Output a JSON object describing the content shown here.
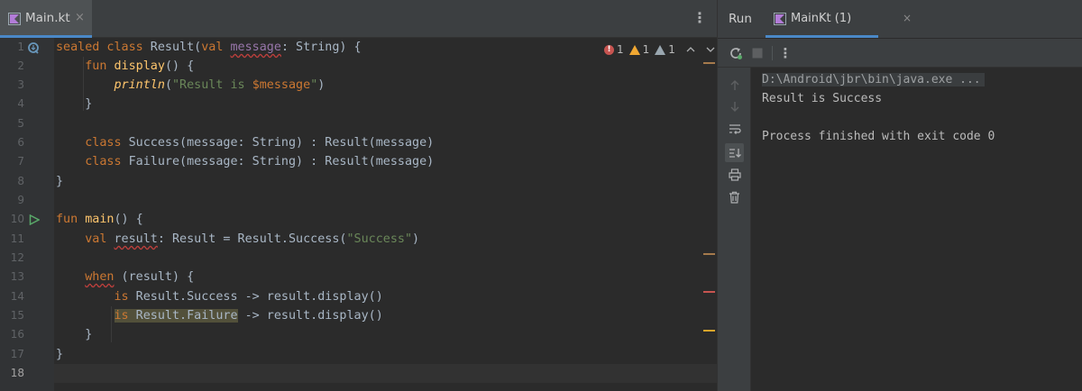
{
  "editor": {
    "tab": {
      "label": "Main.kt",
      "close": "×"
    },
    "more": "⋮",
    "inspections": {
      "errors": "1",
      "warnings": "1",
      "weak_warnings": "1",
      "error_glyph": "!"
    },
    "line_numbers": [
      "1",
      "2",
      "3",
      "4",
      "5",
      "6",
      "7",
      "8",
      "9",
      "10",
      "11",
      "12",
      "13",
      "14",
      "15",
      "16",
      "17",
      "18"
    ],
    "lines": {
      "l1": {
        "kw": "sealed class",
        "name": " Result(",
        "val": "val",
        "sp": " ",
        "prop": "message",
        "rest": ": String) {"
      },
      "l2": {
        "kw": "fun",
        "fn": "display",
        "rest": "() {"
      },
      "l3": {
        "fn": "println",
        "s1": "(",
        "str": "\"Result is ",
        "tpl": "$message",
        "str2": "\"",
        "rest": ")"
      },
      "l4": {
        "text": "}"
      },
      "l6": {
        "kw": "class",
        "rest": " Success(message: String) : Result(message)"
      },
      "l7": {
        "kw": "class",
        "rest": " Failure(message: String) : Result(message)"
      },
      "l8": {
        "text": "}"
      },
      "l10": {
        "kw": "fun",
        "fn": "main",
        "rest": "() {"
      },
      "l11": {
        "kw": "val",
        "var": "result",
        "mid": ": Result = Result.Success(",
        "str": "\"Success\"",
        "rest": ")"
      },
      "l13": {
        "kw": "when",
        "rest": " (result) {"
      },
      "l14": {
        "kw": "is",
        "rest": " Result.Success -> result.display()"
      },
      "l15": {
        "kw": "is",
        "hl": " Result.Failure",
        "rest": " -> result.display()"
      },
      "l16": {
        "text": "}"
      },
      "l17": {
        "text": "}"
      }
    }
  },
  "run": {
    "title": "Run",
    "tab": {
      "label": "MainKt (1)",
      "close": "×"
    },
    "toolbar_more": "⋮",
    "console": [
      "D:\\Android\\jbr\\bin\\java.exe ...",
      "Result is Success",
      "",
      "Process finished with exit code 0"
    ]
  },
  "colors": {
    "keyword": "#cc7832",
    "function": "#ffc66d",
    "property": "#9876aa",
    "string": "#6a8759",
    "plain": "#a9b7c6",
    "error": "#c75450",
    "warning": "#f0a732",
    "accent": "#4a88c7"
  }
}
